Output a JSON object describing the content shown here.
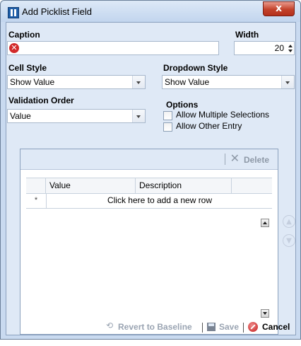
{
  "window": {
    "title": "Add Picklist Field",
    "close_glyph": "x"
  },
  "caption": {
    "label": "Caption",
    "value": ""
  },
  "width": {
    "label": "Width",
    "value": "20"
  },
  "cell_style": {
    "label": "Cell Style",
    "value": "Show Value"
  },
  "dropdown_style": {
    "label": "Dropdown Style",
    "value": "Show Value"
  },
  "validation_order": {
    "label": "Validation Order",
    "value": "Value"
  },
  "options": {
    "label": "Options",
    "allow_multiple": {
      "label": "Allow Multiple Selections",
      "checked": false
    },
    "allow_other": {
      "label": "Allow Other Entry",
      "checked": false
    }
  },
  "grid": {
    "delete_label": "Delete",
    "columns": [
      "Value",
      "Description"
    ],
    "new_row_marker": "*",
    "new_row_text": "Click here to add a new row"
  },
  "footer": {
    "revert_label": "Revert to Baseline",
    "save_label": "Save",
    "cancel_label": "Cancel"
  },
  "colors": {
    "dialog_background": "#dfe9f6",
    "error": "#d22a2a",
    "disabled_text": "#9aa4b2"
  }
}
